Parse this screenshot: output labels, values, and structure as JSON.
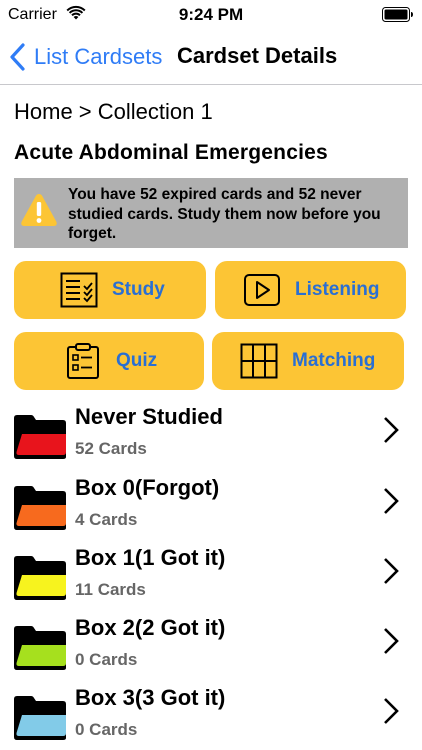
{
  "status_bar": {
    "carrier": "Carrier",
    "time": "9:24 PM"
  },
  "nav": {
    "back_label": "List Cardsets",
    "title": "Cardset Details"
  },
  "breadcrumb": "Home > Collection 1",
  "cardset_title": "Acute Abdominal Emergencies",
  "warning": {
    "text": "You have 52 expired cards and 52 never studied cards. Study them now before you forget."
  },
  "actions": {
    "study": "Study",
    "listening": "Listening",
    "quiz": "Quiz",
    "matching": "Matching"
  },
  "colors": {
    "accent_blue": "#2f7cf6",
    "button_yellow": "#fcc535",
    "warning_gray": "#b0b0b0"
  },
  "boxes": [
    {
      "title": "Never Studied",
      "count": "52 Cards",
      "folder_color": "#e8141c"
    },
    {
      "title": "Box 0(Forgot)",
      "count": "4 Cards",
      "folder_color": "#f76a1e"
    },
    {
      "title": "Box 1(1 Got it)",
      "count": "11 Cards",
      "folder_color": "#f7f31e"
    },
    {
      "title": "Box 2(2 Got it)",
      "count": "0 Cards",
      "folder_color": "#a6e01e"
    },
    {
      "title": "Box 3(3 Got it)",
      "count": "0 Cards",
      "folder_color": "#82cbe8"
    }
  ]
}
